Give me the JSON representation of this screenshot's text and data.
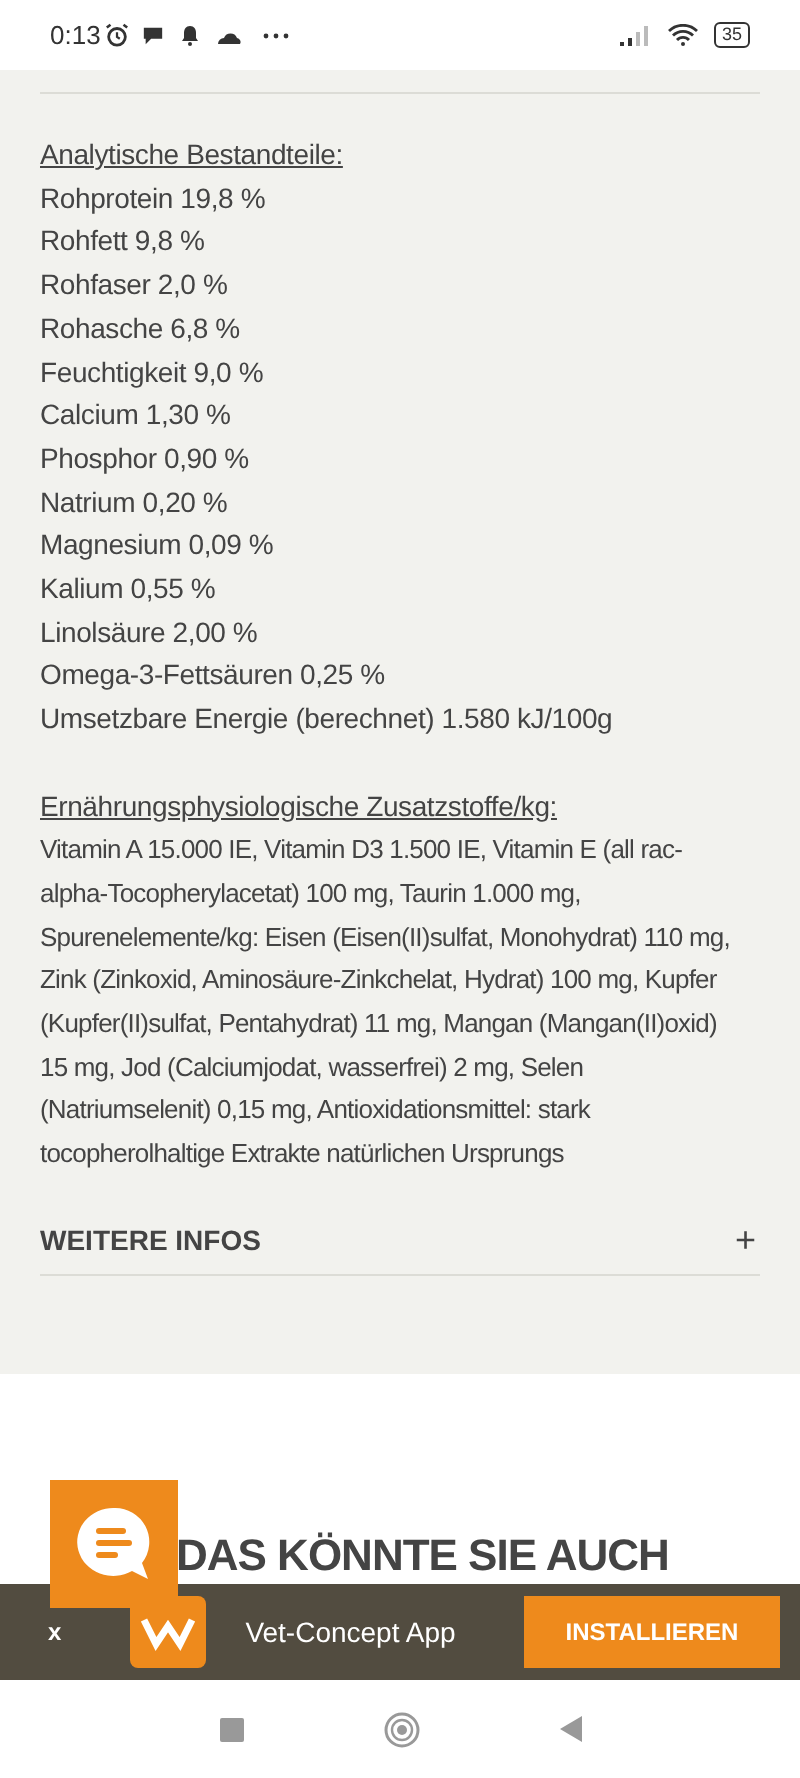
{
  "status_bar": {
    "time": "0:13",
    "battery": "35"
  },
  "analysis": {
    "heading": "Analytische Bestandteile:",
    "items": [
      "Rohprotein 19,8 %",
      "Rohfett 9,8 %",
      "Rohfaser 2,0 %",
      "Rohasche 6,8 %",
      "Feuchtigkeit 9,0 %",
      "Calcium 1,30 %",
      "Phosphor 0,90 %",
      "Natrium 0,20 %",
      "Magnesium 0,09 %",
      "Kalium 0,55 %",
      "Linolsäure 2,00 %",
      "Omega-3-Fettsäuren 0,25 %",
      "Umsetzbare Energie (berechnet) 1.580 kJ/100g"
    ]
  },
  "additives": {
    "heading": "Ernährungsphysiologische Zusatzstoffe/kg:",
    "text": "Vitamin A 15.000 IE, Vitamin D3 1.500 IE, Vitamin E (all rac-alpha-Tocopherylacetat) 100 mg, Taurin 1.000 mg, Spurenelemente/kg: Eisen (Eisen(II)sulfat, Monohydrat) 110 mg, Zink (Zinkoxid, Aminosäure-Zinkchelat, Hydrat) 100 mg, Kupfer (Kupfer(II)sulfat, Pentahydrat) 11 mg, Mangan (Mangan(II)oxid) 15 mg, Jod (Calciumjodat, wasserfrei) 2 mg, Selen (Natriumselenit) 0,15 mg, Antioxidationsmittel: stark tocopherolhaltige Extrakte natürlichen Ursprungs"
  },
  "accordion": {
    "title": "WEITERE INFOS",
    "toggle": "+",
    "expanded": false
  },
  "recommendations": {
    "title": "DAS KÖNNTE SIE AUCH"
  },
  "app_banner": {
    "close": "x",
    "app_name": "Vet-Concept App",
    "button": "INSTALLIEREN"
  }
}
